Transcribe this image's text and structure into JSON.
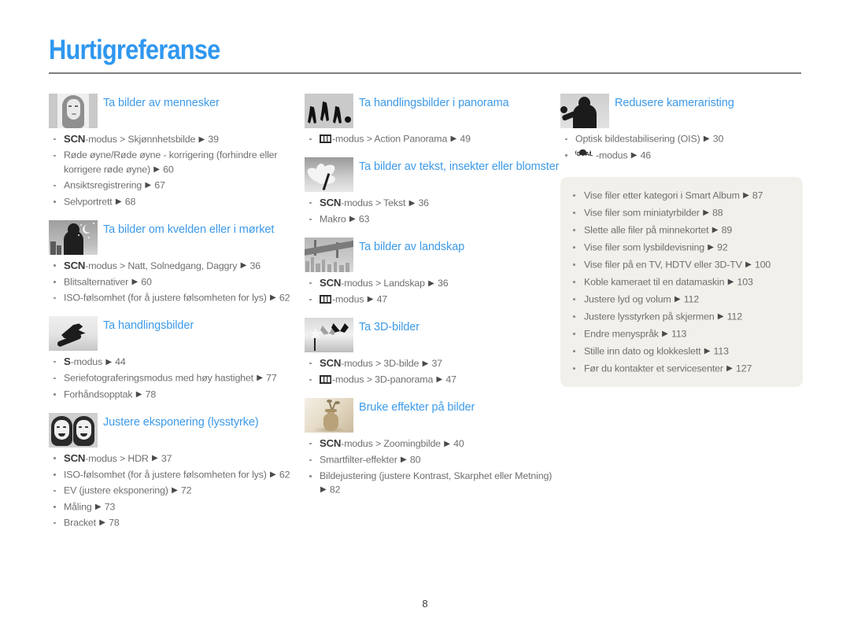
{
  "document": {
    "title": "Hurtigreferanse",
    "page_number": "8"
  },
  "columns": [
    {
      "sections": [
        {
          "icon": "portrait-thumbnail",
          "title": "Ta bilder av mennesker",
          "items": [
            {
              "mode": "SCN",
              "text": "-modus > Skjønnhetsbilde",
              "page": "39"
            },
            {
              "mode": "",
              "text": "Røde øyne/Røde øyne - korrigering (forhindre eller korrigere røde øyne)",
              "page": "60"
            },
            {
              "mode": "",
              "text": "Ansiktsregistrering",
              "page": "67"
            },
            {
              "mode": "",
              "text": "Selvportrett",
              "page": "68"
            }
          ]
        },
        {
          "icon": "night-scene-thumbnail",
          "title": "Ta bilder om kvelden eller i mørket",
          "items": [
            {
              "mode": "SCN",
              "text": "-modus > Natt, Solnedgang, Daggry",
              "page": "36"
            },
            {
              "mode": "",
              "text": "Blitsalternativer",
              "page": "60"
            },
            {
              "mode": "",
              "text": "ISO-følsomhet (for å justere følsomheten for lys)",
              "page": "62"
            }
          ]
        },
        {
          "icon": "snowboarder-thumbnail",
          "title": "Ta handlingsbilder",
          "items": [
            {
              "mode": "S",
              "text": "-modus",
              "page": "44"
            },
            {
              "mode": "",
              "text": "Seriefotograferingsmodus med høy hastighet",
              "page": "77"
            },
            {
              "mode": "",
              "text": "Forhåndsopptak",
              "page": "78"
            }
          ]
        },
        {
          "icon": "two-faces-thumbnail",
          "title": "Justere eksponering (lysstyrke)",
          "items": [
            {
              "mode": "SCN",
              "text": "-modus > HDR",
              "page": "37"
            },
            {
              "mode": "",
              "text": "ISO-følsomhet (for å justere følsomheten for lys)",
              "page": "62"
            },
            {
              "mode": "",
              "text": "EV (justere eksponering)",
              "page": "72"
            },
            {
              "mode": "",
              "text": "Måling",
              "page": "73"
            },
            {
              "mode": "",
              "text": "Bracket",
              "page": "78"
            }
          ]
        }
      ]
    },
    {
      "sections": [
        {
          "icon": "running-players-thumbnail",
          "title": "Ta handlingsbilder i panorama",
          "items": [
            {
              "mode": "PANORAMA",
              "text": "-modus > Action Panorama",
              "page": "49"
            }
          ]
        },
        {
          "icon": "flower-macro-thumbnail",
          "title": "Ta bilder av tekst, insekter eller blomster",
          "items": [
            {
              "mode": "SCN",
              "text": "-modus > Tekst",
              "page": "36"
            },
            {
              "mode": "",
              "text": "Makro",
              "page": "63"
            }
          ]
        },
        {
          "icon": "bridge-landscape-thumbnail",
          "title": "Ta bilder av landskap",
          "items": [
            {
              "mode": "SCN",
              "text": "-modus > Landskap",
              "page": "36"
            },
            {
              "mode": "PANORAMA",
              "text": "-modus",
              "page": "47"
            }
          ]
        },
        {
          "icon": "butterfly-3d-thumbnail",
          "title": "Ta 3D-bilder",
          "items": [
            {
              "mode": "SCN",
              "text": "-modus > 3D-bilde",
              "page": "37"
            },
            {
              "mode": "PANORAMA",
              "text": "-modus > 3D-panorama",
              "page": "47"
            }
          ]
        },
        {
          "icon": "vase-effects-thumbnail",
          "title": "Bruke effekter på bilder",
          "items": [
            {
              "mode": "SCN",
              "text": "-modus > Zoomingbilde",
              "page": "40"
            },
            {
              "mode": "",
              "text": "Smartfilter-effekter",
              "page": "80"
            },
            {
              "mode": "",
              "text": "Bildejustering (justere Kontrast, Skarphet eller Metning)",
              "page": "82"
            }
          ]
        }
      ]
    },
    {
      "sections": [
        {
          "icon": "camera-shake-thumbnail",
          "title": "Redusere kameraristing",
          "items": [
            {
              "mode": "",
              "text": "Optisk bildestabilisering (OIS)",
              "page": "30"
            },
            {
              "mode": "DUAL",
              "text": "-modus",
              "page": "46"
            }
          ]
        }
      ],
      "info_box": {
        "items": [
          {
            "text": "Vise filer etter kategori i Smart Album",
            "page": "87"
          },
          {
            "text": "Vise filer som miniatyrbilder",
            "page": "88"
          },
          {
            "text": "Slette alle filer på minnekortet",
            "page": "89"
          },
          {
            "text": "Vise filer som lysbildevisning",
            "page": "92"
          },
          {
            "text": "Vise filer på en TV, HDTV eller 3D-TV",
            "page": "100"
          },
          {
            "text": "Koble kameraet til en datamaskin",
            "page": "103"
          },
          {
            "text": "Justere lyd og volum",
            "page": "112"
          },
          {
            "text": "Justere lysstyrken på skjermen",
            "page": "112"
          },
          {
            "text": "Endre menyspråk",
            "page": "113"
          },
          {
            "text": "Stille inn dato og klokkeslett",
            "page": "113"
          },
          {
            "text": "Før du kontakter et servicesenter",
            "page": "127"
          }
        ]
      }
    }
  ],
  "colors": {
    "heading_blue": "#3d9ae8",
    "title_blue": "#2f97ef",
    "body_gray": "#6f6f6f",
    "info_box_bg": "#f2f0eb"
  }
}
